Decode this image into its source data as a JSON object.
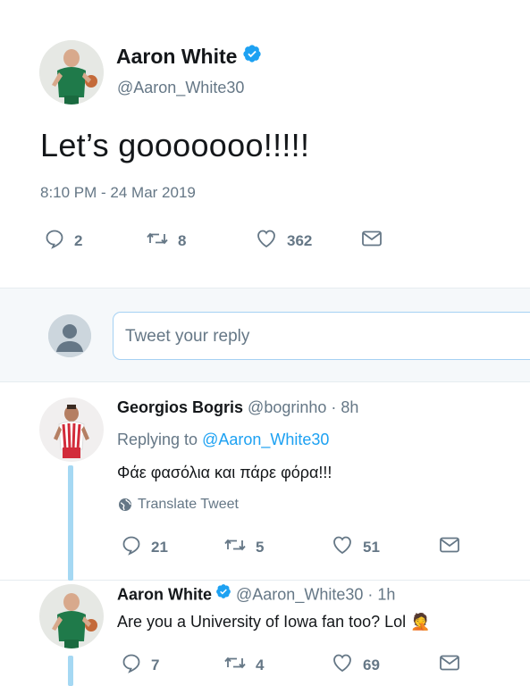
{
  "main_tweet": {
    "display_name": "Aaron White",
    "handle": "@Aaron_White30",
    "text": "Let’s gooooooo!!!!!",
    "timestamp": "8:10 PM - 24 Mar 2019",
    "actions": {
      "replies": "2",
      "retweets": "8",
      "likes": "362"
    }
  },
  "reply_box": {
    "placeholder": "Tweet your reply"
  },
  "replies": [
    {
      "display_name": "Georgios Bogris",
      "handle_time": "@bogrinho · 8h",
      "replying_to_prefix": "Replying to ",
      "replying_to": "@Aaron_White30",
      "text": "Φάε φασόλια και πάρε φόρα!!!",
      "translate_label": "Translate Tweet",
      "actions": {
        "replies": "21",
        "retweets": "5",
        "likes": "51"
      }
    },
    {
      "display_name": "Aaron White",
      "handle_time": "@Aaron_White30 · 1h",
      "text": "Are you a University of Iowa fan too? Lol 🤦",
      "actions": {
        "replies": "7",
        "retweets": "4",
        "likes": "69"
      }
    }
  ],
  "colors": {
    "accent": "#1da1f2",
    "muted": "#657786",
    "text": "#14171a",
    "thread_line": "#a5d8f3"
  }
}
